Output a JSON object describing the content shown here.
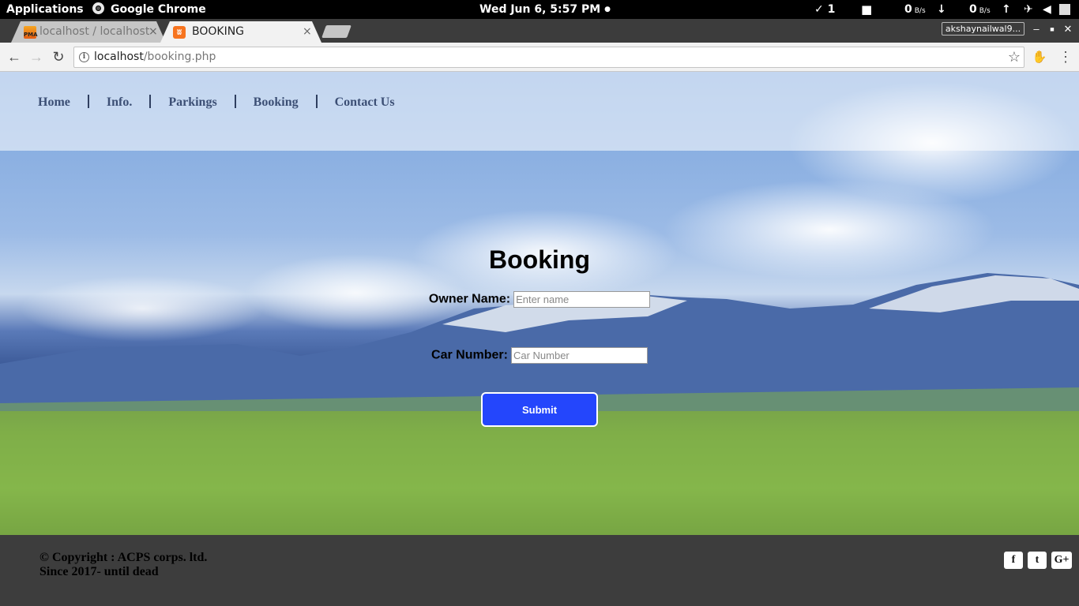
{
  "os_panel": {
    "applications": "Applications",
    "app_name": "Google Chrome",
    "clock": "Wed Jun  6,  5:57 PM",
    "clock_dot": "●",
    "updates_count": "1",
    "net_down_value": "0",
    "net_down_unit": "B/s",
    "net_up_value": "0",
    "net_up_unit": "B/s"
  },
  "browser": {
    "tabs": [
      {
        "title": "localhost / localhost",
        "favicon": "pma-favicon",
        "active": false
      },
      {
        "title": "BOOKING",
        "favicon": "xampp-favicon",
        "active": true
      }
    ],
    "tab_close_glyph": "×",
    "profile_name": "akshaynailwal9...",
    "url_host": "localhost",
    "url_path": "/booking.php"
  },
  "site": {
    "nav": [
      "Home",
      "Info.",
      "Parkings",
      "Booking",
      "Contact Us"
    ],
    "form": {
      "title": "Booking",
      "owner_label": "Owner Name:",
      "owner_placeholder": "Enter name",
      "owner_value": "",
      "car_label": "Car Number:",
      "car_placeholder": "Car Number",
      "car_value": "",
      "submit_label": "Submit"
    },
    "footer": {
      "copyright_line1": "© Copyright : ACPS corps. ltd.",
      "copyright_line2": "Since 2017- until dead",
      "social": [
        {
          "name": "facebook-icon",
          "glyph": "f"
        },
        {
          "name": "twitter-icon",
          "glyph": "t"
        },
        {
          "name": "google-plus-icon",
          "glyph": "G+"
        }
      ]
    }
  },
  "colors": {
    "submit_bg": "#2446fc",
    "nav_text": "#3c4f75",
    "footer_bg": "#3d3d3d"
  }
}
